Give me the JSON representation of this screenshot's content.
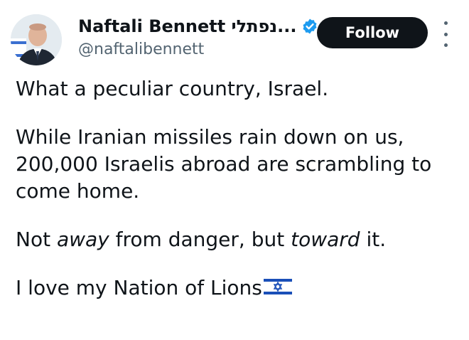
{
  "author": {
    "display_name": "Naftali Bennett נפתלי...",
    "handle": "@naftalibennett",
    "verified": true,
    "avatar_icon": "profile-photo"
  },
  "actions": {
    "follow_label": "Follow",
    "more_icon": "more-vertical-icon"
  },
  "tweet": {
    "line1": "What a peculiar country, Israel.",
    "para2": "While Iranian missiles rain down on us, 200,000 Israelis abroad are scrambling to come home.",
    "para3": {
      "t1": "Not ",
      "em1": "away",
      "t2": " from danger, but ",
      "em2": "toward",
      "t3": " it."
    },
    "line4": "I love my Nation of Lions",
    "emoji": "israel-flag-emoji"
  },
  "colors": {
    "verified_blue": "#1d9bf0",
    "follow_bg": "#0f1419",
    "handle_gray": "#536471"
  }
}
